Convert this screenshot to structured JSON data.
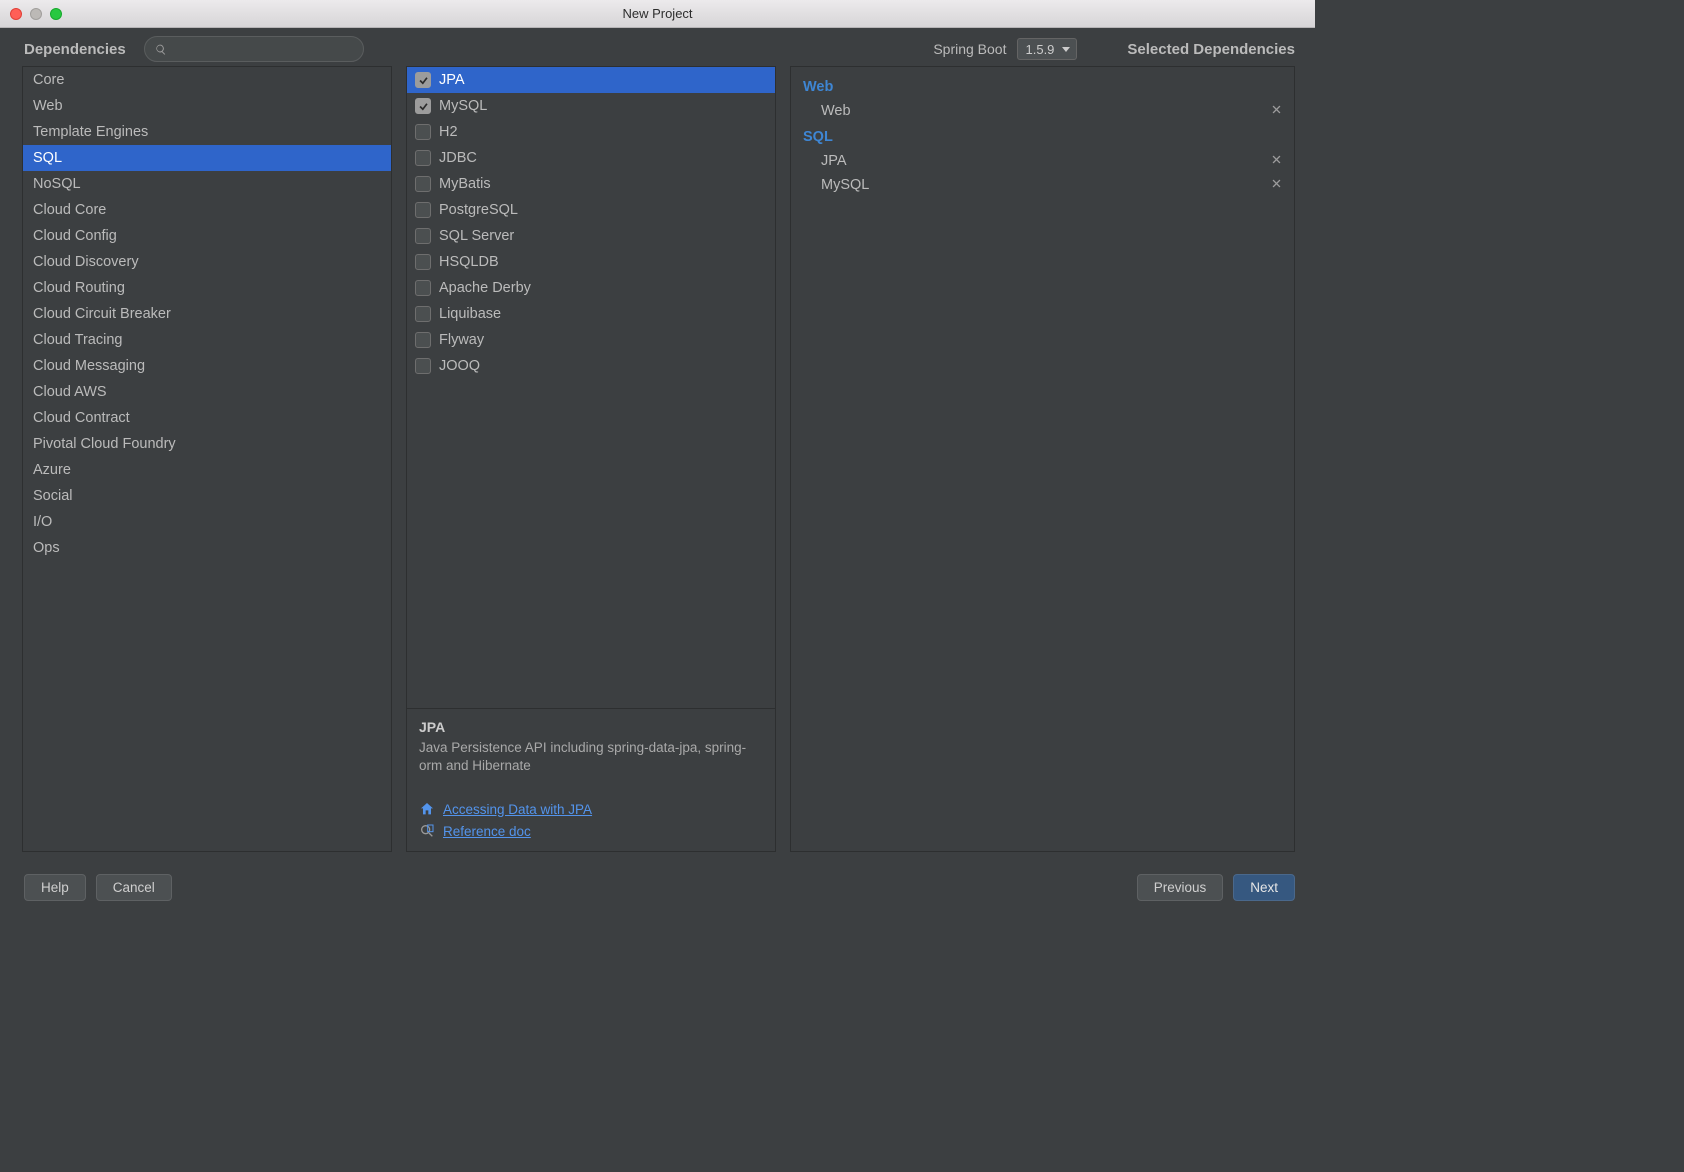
{
  "window": {
    "title": "New Project"
  },
  "header": {
    "dependencies_label": "Dependencies",
    "search_placeholder": "",
    "spring_boot_label": "Spring Boot",
    "spring_boot_version": "1.5.9",
    "selected_title": "Selected Dependencies"
  },
  "categories": {
    "selected_index": 3,
    "items": [
      "Core",
      "Web",
      "Template Engines",
      "SQL",
      "NoSQL",
      "Cloud Core",
      "Cloud Config",
      "Cloud Discovery",
      "Cloud Routing",
      "Cloud Circuit Breaker",
      "Cloud Tracing",
      "Cloud Messaging",
      "Cloud AWS",
      "Cloud Contract",
      "Pivotal Cloud Foundry",
      "Azure",
      "Social",
      "I/O",
      "Ops"
    ]
  },
  "deps": {
    "selected_index": 0,
    "items": [
      {
        "label": "JPA",
        "checked": true
      },
      {
        "label": "MySQL",
        "checked": true
      },
      {
        "label": "H2",
        "checked": false
      },
      {
        "label": "JDBC",
        "checked": false
      },
      {
        "label": "MyBatis",
        "checked": false
      },
      {
        "label": "PostgreSQL",
        "checked": false
      },
      {
        "label": "SQL Server",
        "checked": false
      },
      {
        "label": "HSQLDB",
        "checked": false
      },
      {
        "label": "Apache Derby",
        "checked": false
      },
      {
        "label": "Liquibase",
        "checked": false
      },
      {
        "label": "Flyway",
        "checked": false
      },
      {
        "label": "JOOQ",
        "checked": false
      }
    ]
  },
  "description": {
    "title": "JPA",
    "text": "Java Persistence API including spring-data-jpa, spring-orm and Hibernate",
    "links": [
      {
        "label": "Accessing Data with JPA",
        "icon": "home"
      },
      {
        "label": "Reference doc",
        "icon": "doc"
      }
    ]
  },
  "selected": {
    "groups": [
      {
        "title": "Web",
        "items": [
          "Web"
        ]
      },
      {
        "title": "SQL",
        "items": [
          "JPA",
          "MySQL"
        ]
      }
    ]
  },
  "buttons": {
    "help": "Help",
    "cancel": "Cancel",
    "previous": "Previous",
    "next": "Next"
  }
}
